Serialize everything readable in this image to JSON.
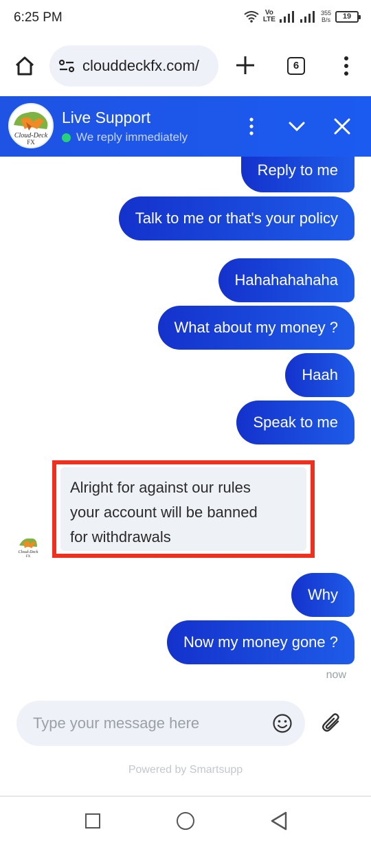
{
  "status_bar": {
    "time": "6:25 PM",
    "volte_line1": "Vo",
    "volte_line2": "LTE",
    "speed_value": "355",
    "speed_unit": "B/s",
    "battery": "19"
  },
  "browser": {
    "url": "clouddeckfx.com/",
    "tab_count": "6"
  },
  "chat_header": {
    "title": "Live Support",
    "subtitle": "We reply immediately",
    "logo_text": "Cloud-Deck FX",
    "online_color": "#27d07a",
    "accent": "#1e53e3"
  },
  "messages": [
    {
      "direction": "outgoing",
      "text": "Reply to me"
    },
    {
      "direction": "outgoing",
      "text": "Talk to me or that's your policy"
    },
    {
      "direction": "outgoing",
      "text": "Hahahahahaha"
    },
    {
      "direction": "outgoing",
      "text": "What about my money ?"
    },
    {
      "direction": "outgoing",
      "text": "Haah"
    },
    {
      "direction": "outgoing",
      "text": "Speak to me"
    },
    {
      "direction": "incoming",
      "lines": [
        "Alright for against our rules",
        "your account will be banned",
        "for withdrawals"
      ]
    },
    {
      "direction": "outgoing",
      "text": "Why"
    },
    {
      "direction": "outgoing",
      "text": "Now my money gone ?"
    }
  ],
  "timestamp": "now",
  "composer": {
    "placeholder": "Type your message here"
  },
  "footer": {
    "powered_by": "Powered by Smartsupp"
  },
  "icons": {
    "home": "home-icon",
    "tune": "site-settings-icon",
    "new_tab": "plus-icon",
    "menu": "more-vert-icon",
    "minimize": "chevron-down-icon",
    "close": "close-icon",
    "emoji": "emoji-icon",
    "attach": "paperclip-icon"
  }
}
